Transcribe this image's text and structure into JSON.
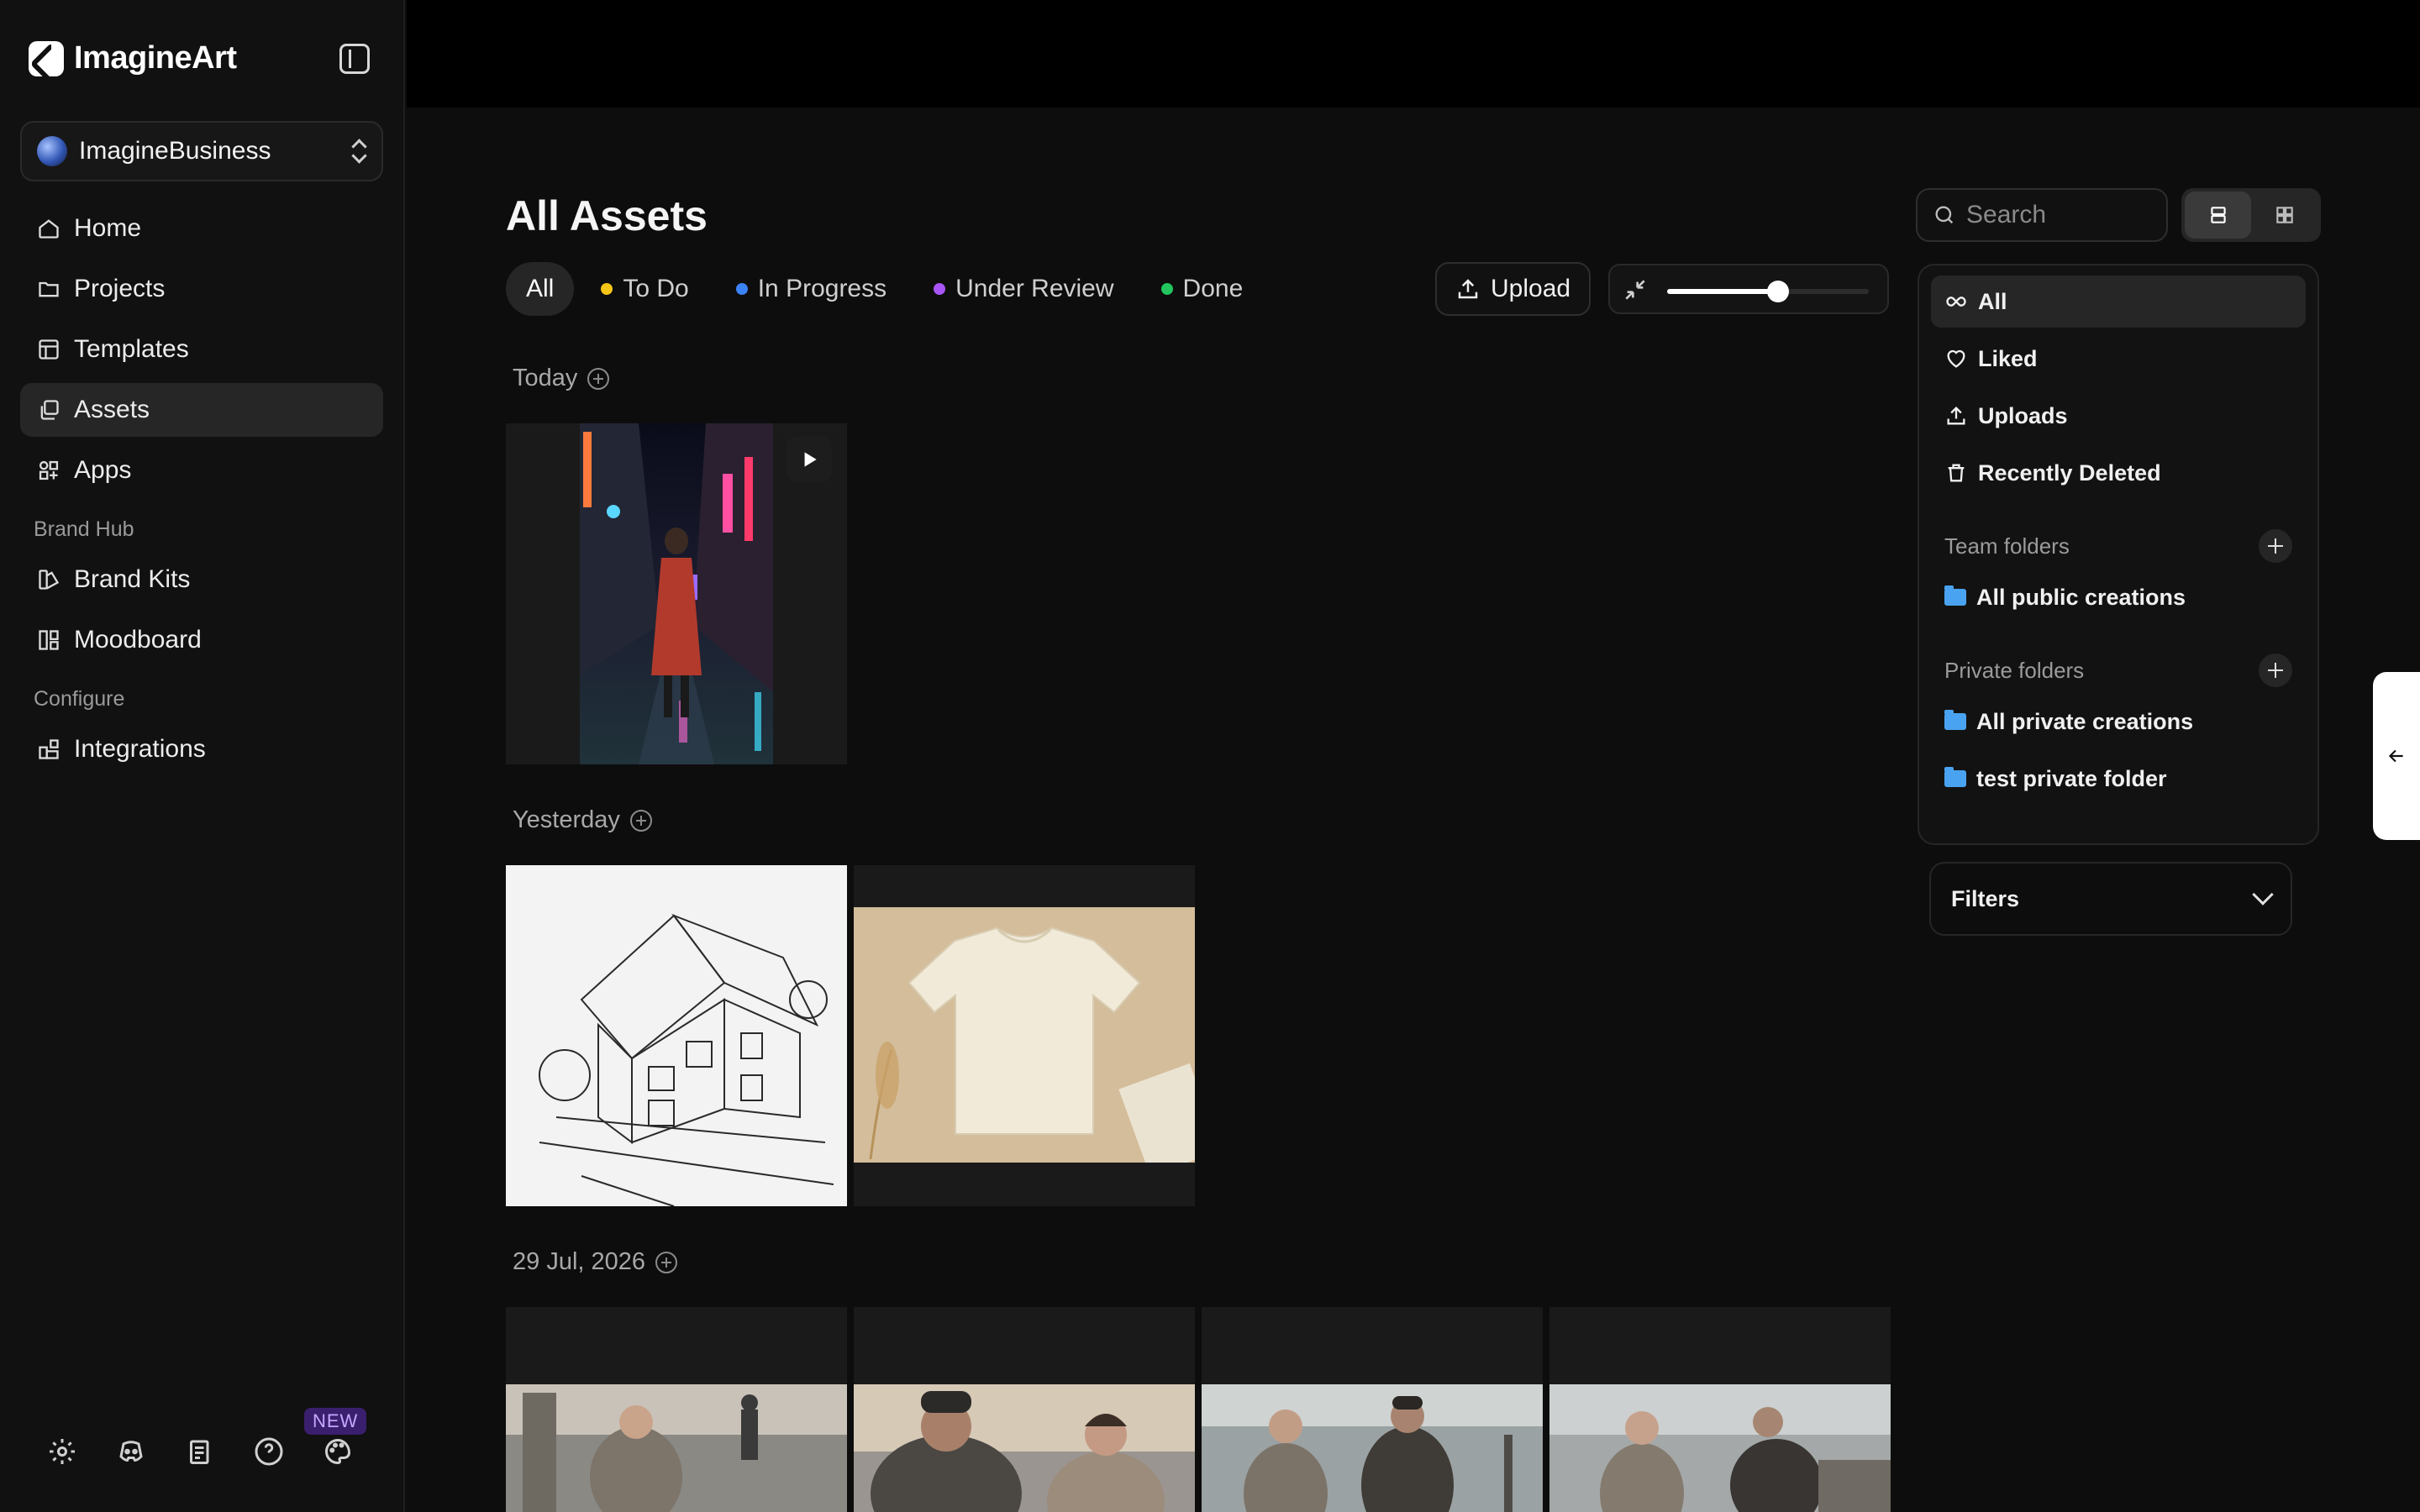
{
  "app": {
    "name": "ImagineArt"
  },
  "workspace": {
    "name": "ImagineBusiness"
  },
  "nav": {
    "primary": [
      {
        "label": "Home",
        "icon": "home-icon"
      },
      {
        "label": "Projects",
        "icon": "folder-icon"
      },
      {
        "label": "Templates",
        "icon": "template-icon"
      },
      {
        "label": "Assets",
        "icon": "assets-icon",
        "active": true
      },
      {
        "label": "Apps",
        "icon": "apps-icon"
      }
    ],
    "brand_hub": {
      "label": "Brand Hub",
      "items": [
        {
          "label": "Brand Kits",
          "icon": "brand-kit-icon"
        },
        {
          "label": "Moodboard",
          "icon": "moodboard-icon"
        }
      ]
    },
    "configure": {
      "label": "Configure",
      "items": [
        {
          "label": "Integrations",
          "icon": "integrations-icon"
        }
      ]
    }
  },
  "footer": {
    "new_badge": "NEW",
    "icons": [
      "settings-icon",
      "discord-icon",
      "docs-icon",
      "help-icon",
      "palette-icon"
    ]
  },
  "main": {
    "title": "All Assets",
    "status_tabs": [
      {
        "label": "All",
        "active": true
      },
      {
        "label": "To Do",
        "color": "#f5c518"
      },
      {
        "label": "In Progress",
        "color": "#3b82f6"
      },
      {
        "label": "Under Review",
        "color": "#a855f7"
      },
      {
        "label": "Done",
        "color": "#22c55e"
      }
    ],
    "upload_label": "Upload",
    "zoom_level": 0.55,
    "groups": [
      {
        "label": "Today",
        "assets": [
          {
            "type": "video",
            "subject": "woman-neon-street"
          }
        ]
      },
      {
        "label": "Yesterday",
        "assets": [
          {
            "type": "image",
            "subject": "house-sketch"
          },
          {
            "type": "image",
            "subject": "tshirt-mockup"
          }
        ]
      },
      {
        "label": "29 Jul, 2026",
        "assets": [
          {
            "type": "image",
            "subject": "harbor-scene"
          },
          {
            "type": "image",
            "subject": "harbor-scene"
          },
          {
            "type": "image",
            "subject": "harbor-scene"
          },
          {
            "type": "image",
            "subject": "harbor-scene"
          }
        ]
      }
    ]
  },
  "right_panel": {
    "search_placeholder": "Search",
    "items": [
      {
        "label": "All",
        "icon": "infinity-icon",
        "active": true
      },
      {
        "label": "Liked",
        "icon": "heart-icon"
      },
      {
        "label": "Uploads",
        "icon": "upload-icon"
      },
      {
        "label": "Recently Deleted",
        "icon": "trash-icon"
      }
    ],
    "team_folders": {
      "label": "Team folders",
      "items": [
        "All public creations"
      ]
    },
    "private_folders": {
      "label": "Private folders",
      "items": [
        "All private creations",
        "test private folder"
      ]
    },
    "filters_label": "Filters"
  }
}
